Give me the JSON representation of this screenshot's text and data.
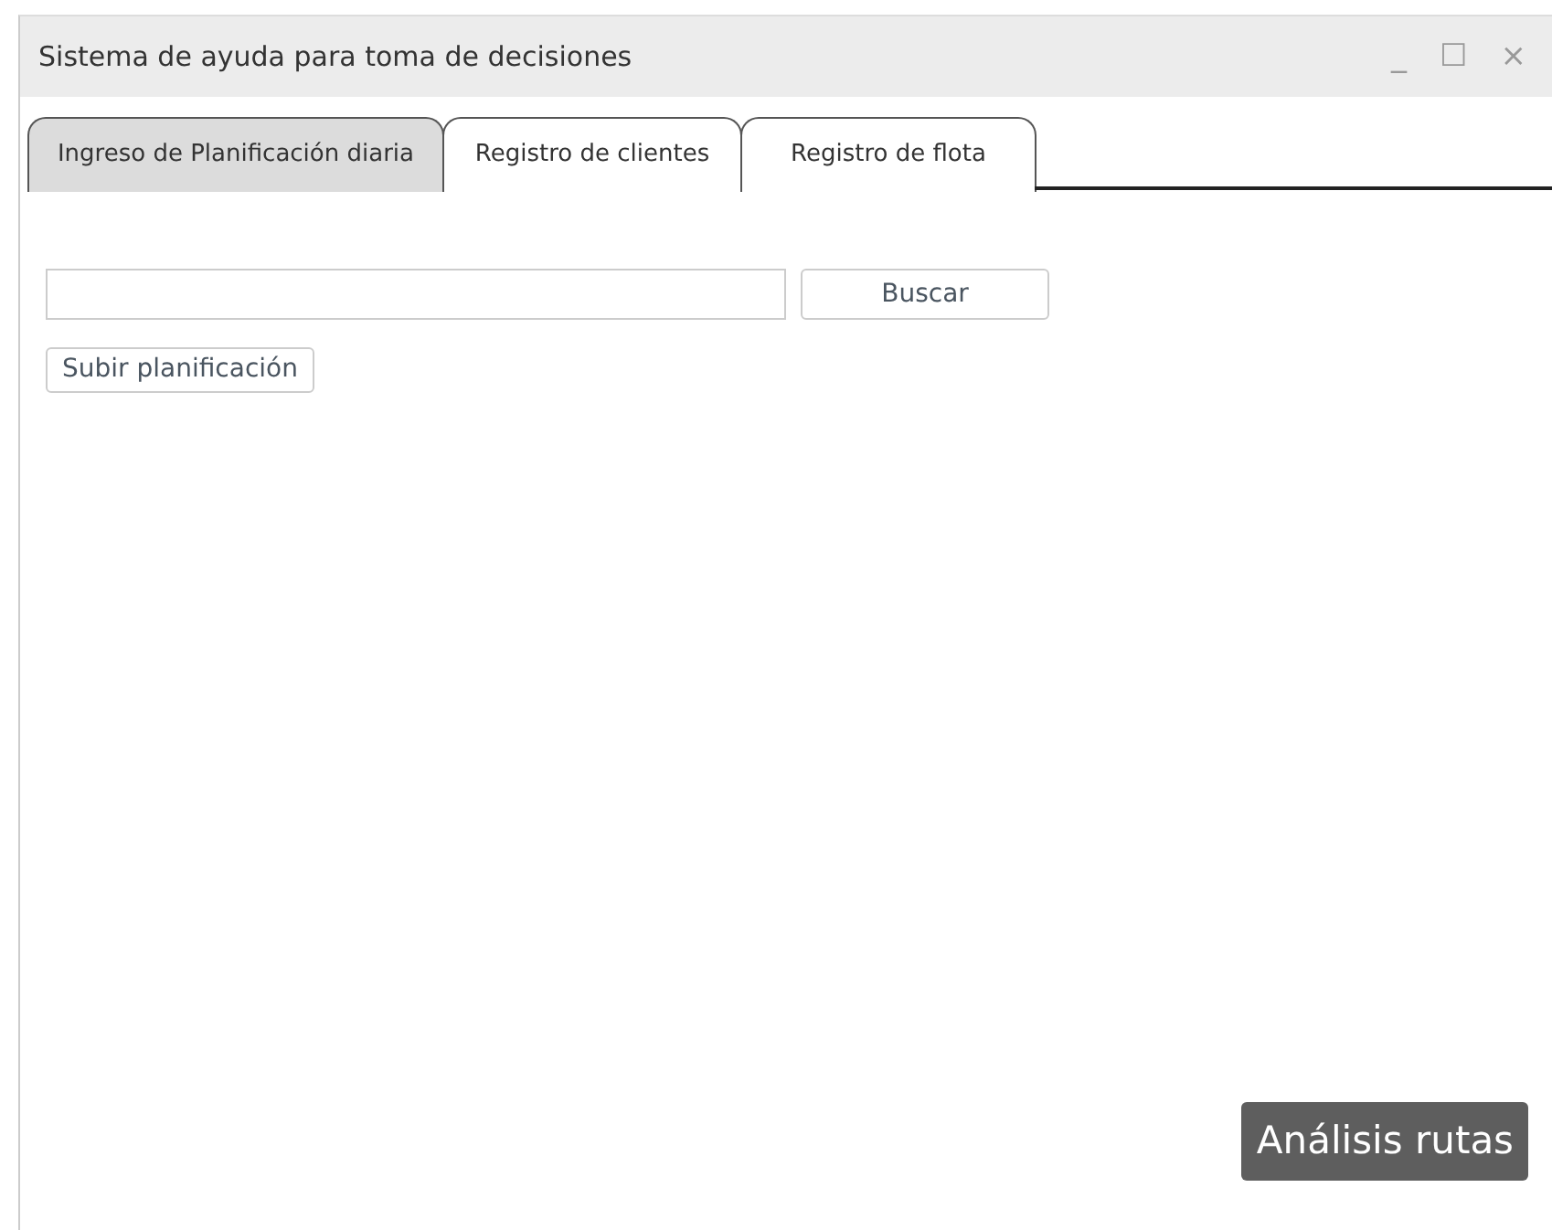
{
  "window": {
    "title": "Sistema de ayuda para toma de decisiones",
    "controls": [
      "_",
      "☐",
      "×"
    ]
  },
  "tabs": [
    {
      "label": "Ingreso de Planificación diaria",
      "selected": true
    },
    {
      "label": "Registro de clientes",
      "selected": false
    },
    {
      "label": "Registro de flota",
      "selected": false
    }
  ],
  "search": {
    "button": "Buscar"
  },
  "upload_button": "Subir planificación",
  "analysis_button": "Análisis rutas"
}
